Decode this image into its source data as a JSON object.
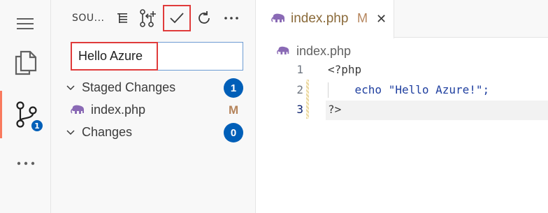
{
  "activity_bar": {
    "items": [
      "menu-icon",
      "explorer-icon",
      "source-control-icon",
      "more-icon"
    ],
    "scm_badge": "1"
  },
  "scm": {
    "title": "SOU...",
    "toolbar_icons": [
      "view-as-tree-icon",
      "create-pull-request-icon",
      "commit-check-icon",
      "refresh-icon",
      "more-actions-icon"
    ],
    "commit_message": "Hello Azure",
    "staged": {
      "label": "Staged Changes",
      "count": "1",
      "files": [
        {
          "name": "index.php",
          "status": "M"
        }
      ]
    },
    "changes": {
      "label": "Changes",
      "count": "0"
    }
  },
  "editor": {
    "tab": {
      "name": "index.php",
      "status": "M",
      "close": "✕"
    },
    "breadcrumb": "index.php",
    "lines": [
      {
        "num": "1",
        "text": "<?php"
      },
      {
        "num": "2",
        "text": "    echo \"Hello Azure!\";"
      },
      {
        "num": "3",
        "text": "?>"
      }
    ]
  },
  "colors": {
    "accent": "#005fb8",
    "highlight": "#e03b3b",
    "modified": "#b5845b",
    "php_icon": "#8a6ab5"
  }
}
